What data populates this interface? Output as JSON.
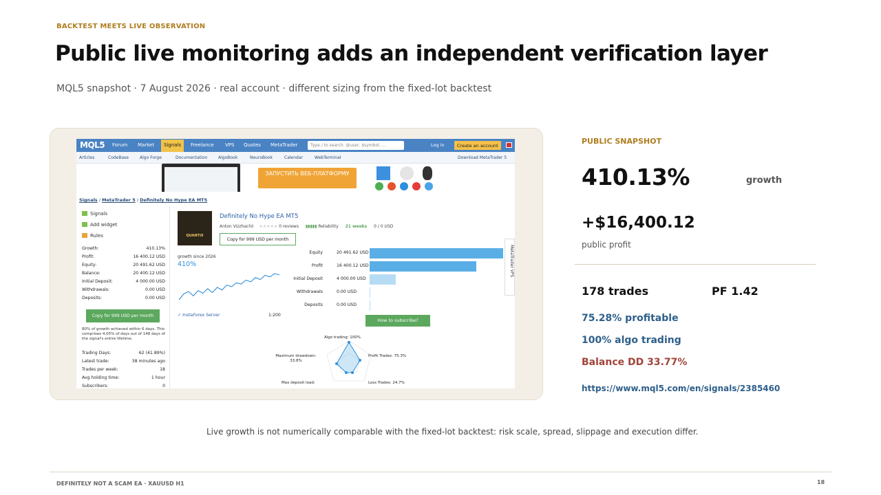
{
  "slide": {
    "kicker": "BACKTEST MEETS LIVE OBSERVATION",
    "title": "Public live monitoring adds an independent verification layer",
    "subtitle": "MQL5 snapshot · 7 August 2026 · real account · different sizing from the fixed-lot backtest",
    "caption": "Live growth is not numerically comparable with the fixed-lot backtest: risk scale, spread, slippage and execution differ.",
    "footer": "DEFINITELY NOT A SCAM EA · XAUUSD H1",
    "page_number": "18"
  },
  "panel": {
    "label": "PUBLIC SNAPSHOT",
    "growth_value": "410.13%",
    "growth_label": "growth",
    "profit_value": "+$16,400.12",
    "profit_label": "public profit",
    "trades": "178 trades",
    "pf": "PF 1.42",
    "profitable": "75.28% profitable",
    "algo": "100% algo trading",
    "balance_dd": "Balance DD 33.77%",
    "url": "https://www.mql5.com/en/signals/2385460",
    "colors": {
      "accent": "#b07d1e",
      "blue": "#2e5f8a",
      "red": "#a2443b"
    }
  },
  "screenshot": {
    "nav": {
      "logo": "MQL5",
      "items": [
        "Forum",
        "Market",
        "Signals",
        "Freelance",
        "VPS",
        "Quotes",
        "MetaTrader"
      ],
      "search_placeholder": "Type  /  to search: @user, $symbol, ...",
      "login": "Log in",
      "create": "Create an account"
    },
    "subnav": [
      "Articles",
      "CodeBase",
      "Algo Forge",
      "Documentation",
      "AlgoBook",
      "NeuroBook",
      "Calendar",
      "WebTerminal",
      "Download MetaTrader 5"
    ],
    "banner_button": "ЗАПУСТИТЬ ВЕБ-ПЛАТФОРМУ",
    "breadcrumb": [
      "Signals",
      "MetaTrader 5",
      "Definitely No Hype EA MT5"
    ],
    "left_menu": [
      "Signals",
      "Add widget",
      "Rules"
    ],
    "stats": [
      {
        "label": "Growth:",
        "value": "410.13%"
      },
      {
        "label": "Profit:",
        "value": "16 400.12 USD"
      },
      {
        "label": "Equity:",
        "value": "20 491.62 USD"
      },
      {
        "label": "Balance:",
        "value": "20 400.12 USD"
      },
      {
        "label": "Initial Deposit:",
        "value": "4 000.00 USD"
      },
      {
        "label": "Withdrawals:",
        "value": "0.00 USD"
      },
      {
        "label": "Deposits:",
        "value": "0.00 USD"
      }
    ],
    "left_button": "Copy for 999 USD per month",
    "note": "80% of growth achieved within 6 days. This comprises 4.05% of days out of 148 days of the signal's entire lifetime.",
    "stats2": [
      {
        "label": "Trading Days:",
        "value": "62 (41.89%)"
      },
      {
        "label": "Latest trade:",
        "value": "38 minutes ago"
      },
      {
        "label": "Trades per week:",
        "value": "18"
      },
      {
        "label": "Avg holding time:",
        "value": "1 hour"
      },
      {
        "label": "Subscribers:",
        "value": "0"
      }
    ],
    "thumb_text": "QUANTIX",
    "signal_title": "Definitely No Hype EA MT5",
    "author": "Anton Vizzhachii",
    "reviews": "0 reviews",
    "reliability": "Reliability",
    "weeks": "21 weeks",
    "subscribers_funds": "0 / 0 USD",
    "copy_button": "Copy for 999 USD per month",
    "growth_since": "growth since 2026",
    "growth_pct": "410%",
    "growth_series": [
      0,
      18,
      25,
      12,
      28,
      20,
      34,
      22,
      38,
      30,
      45,
      40,
      52,
      48,
      60,
      55,
      68,
      62,
      75,
      70,
      80,
      76
    ],
    "bars": [
      {
        "label": "Equity",
        "value_text": "20 491.62 USD",
        "value": 20491.62
      },
      {
        "label": "Profit",
        "value_text": "16 400.12 USD",
        "value": 16400.12
      },
      {
        "label": "Initial Deposit",
        "value_text": "4 000.00 USD",
        "value": 4000.0
      },
      {
        "label": "Withdrawals",
        "value_text": "0.00 USD",
        "value": 0
      },
      {
        "label": "Deposits",
        "value_text": "0.00 USD",
        "value": 0
      }
    ],
    "bar_colors": [
      "#5aaee6",
      "#5aaee6",
      "#b6dcf4",
      "#b6dcf4",
      "#b6dcf4"
    ],
    "server": "InstaForex Server",
    "leverage": "1:200",
    "subscribe_button": "How to subscribe?",
    "side_tab": "MetaTrader VPS",
    "radar": {
      "algo": "Algo trading: 100%",
      "max_dd": "Maximum drawdown: 33.8%",
      "profit_trades": "Profit Trades: 75.3%",
      "max_deposit_load": "Max deposit load:",
      "loss_trades": "Loss Trades: 24.7%"
    }
  }
}
